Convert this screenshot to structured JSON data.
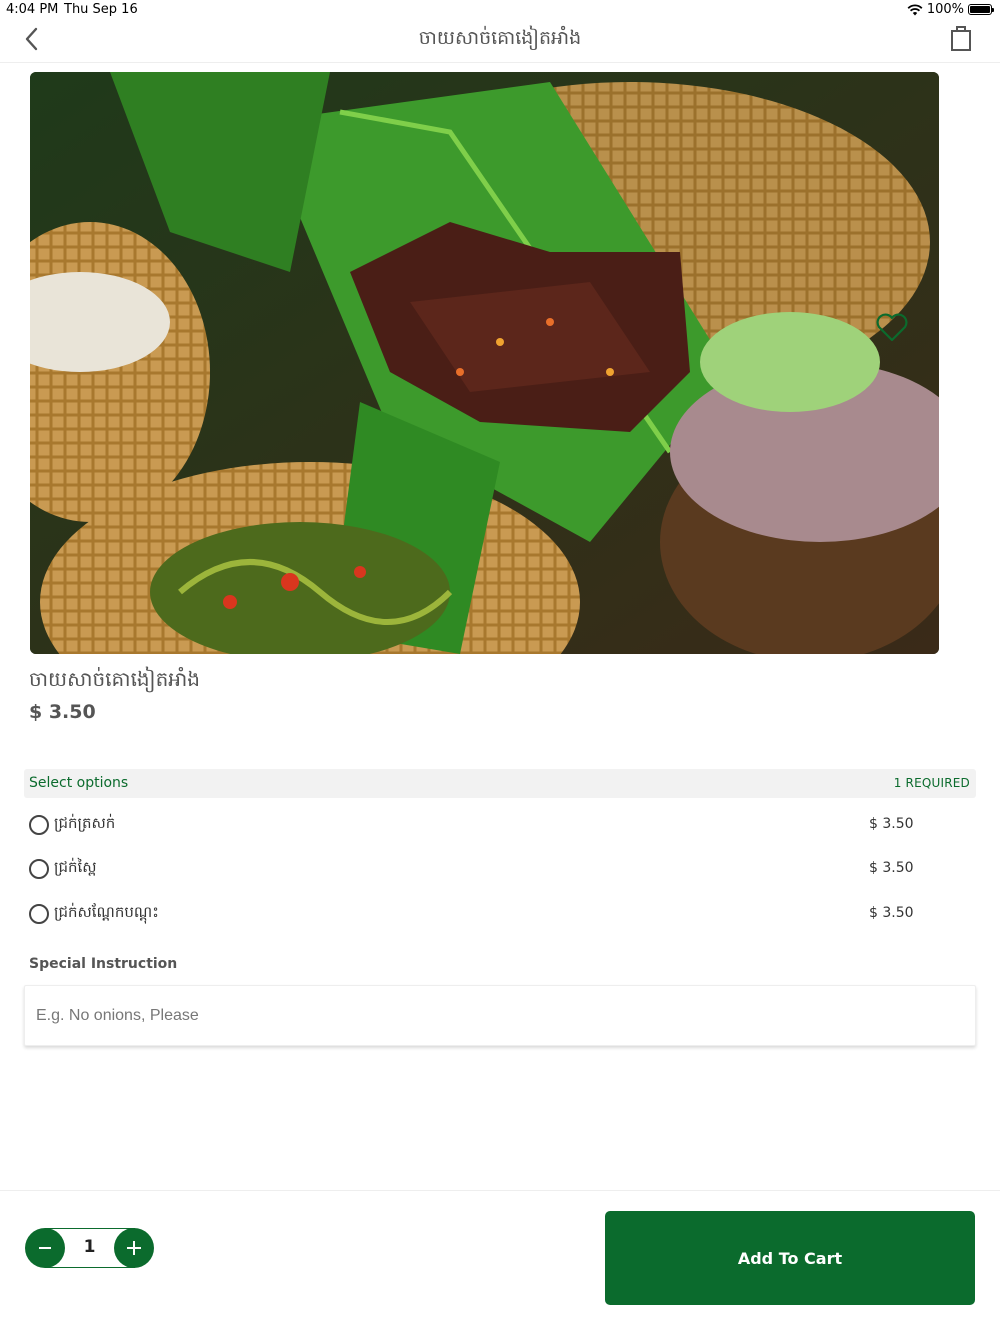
{
  "status": {
    "time": "4:04 PM",
    "date": "Thu Sep 16",
    "battery": "100%",
    "battery_level": 1.0
  },
  "nav": {
    "title": "ចាយសាច់គោងៀតអាំង",
    "back_icon": "chevron-left-icon",
    "cart_icon": "shopping-bag-icon"
  },
  "product": {
    "name": "ចាយសាច់គោងៀតអាំង",
    "price": "$ 3.50",
    "favorite_icon": "heart-icon"
  },
  "options": {
    "title": "Select options",
    "required": "1 REQUIRED",
    "items": [
      {
        "label": "ជ្រក់ត្រសក់",
        "price": "$ 3.50"
      },
      {
        "label": "ជ្រក់ស្ពៃ",
        "price": "$ 3.50"
      },
      {
        "label": "ជ្រក់សណ្តែកបណ្តុះ",
        "price": "$ 3.50"
      }
    ]
  },
  "special": {
    "label": "Special Instruction",
    "placeholder": "E.g. No onions, Please",
    "value": ""
  },
  "cart": {
    "quantity": "1",
    "add_label": "Add To Cart"
  },
  "colors": {
    "accent": "#0b6b2d",
    "header_bg": "#f2f2f2",
    "text": "#555555"
  }
}
